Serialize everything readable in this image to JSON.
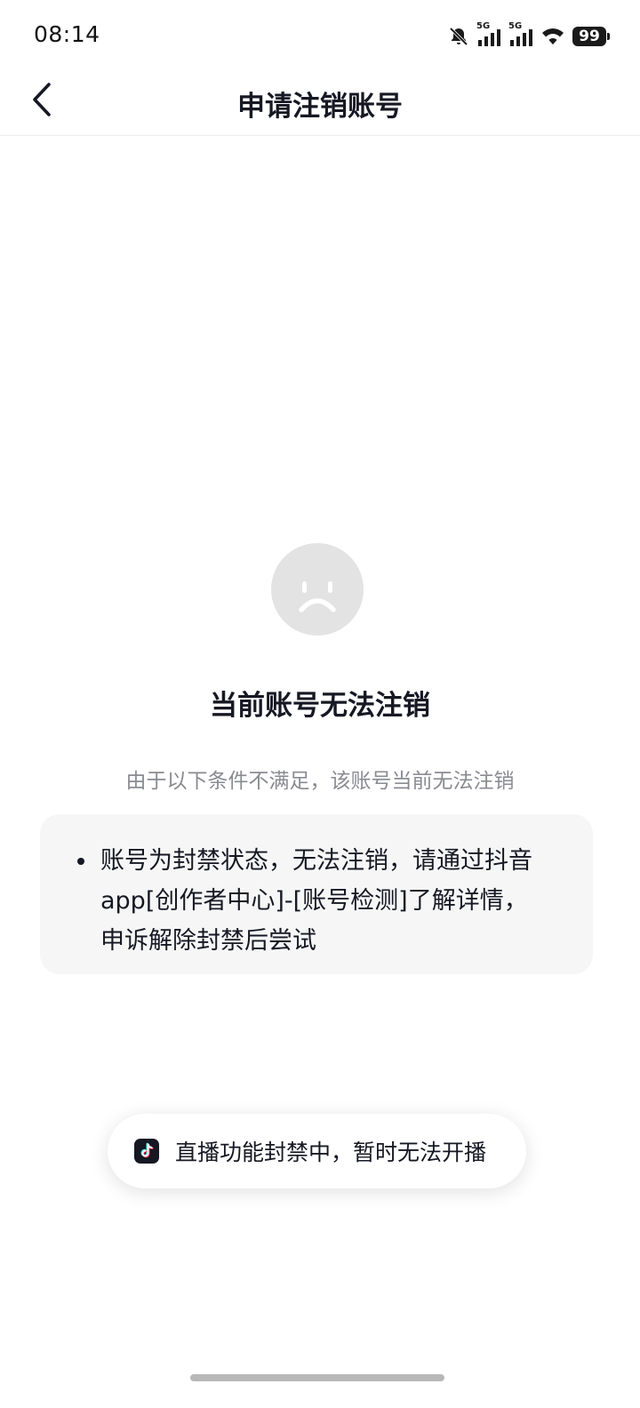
{
  "status_bar": {
    "time": "08:14",
    "network_1": "5G",
    "network_2": "5G",
    "battery": "99",
    "icons": [
      "bell-muted-icon",
      "signal-5g-icon",
      "signal-5g-icon",
      "wifi-icon",
      "battery-icon"
    ]
  },
  "nav": {
    "title": "申请注销账号",
    "back_icon": "chevron-left-icon"
  },
  "result": {
    "icon": "sad-face-icon",
    "title": "当前账号无法注销",
    "subtitle": "由于以下条件不满足，该账号当前无法注销"
  },
  "reasons": [
    {
      "lines": [
        "账号为封禁状态，无法注销，请通过抖音",
        "app[创作者中心]-[账号检测]了解详情，",
        "申诉解除封禁后尝试"
      ]
    }
  ],
  "toast": {
    "icon": "douyin-logo-icon",
    "text": "直播功能封禁中，暂时无法开播"
  },
  "colors": {
    "background": "#ffffff",
    "text_primary": "#161823",
    "text_secondary": "#8a8b91",
    "card_background": "#f6f6f7",
    "face_background": "#e3e3e4"
  }
}
